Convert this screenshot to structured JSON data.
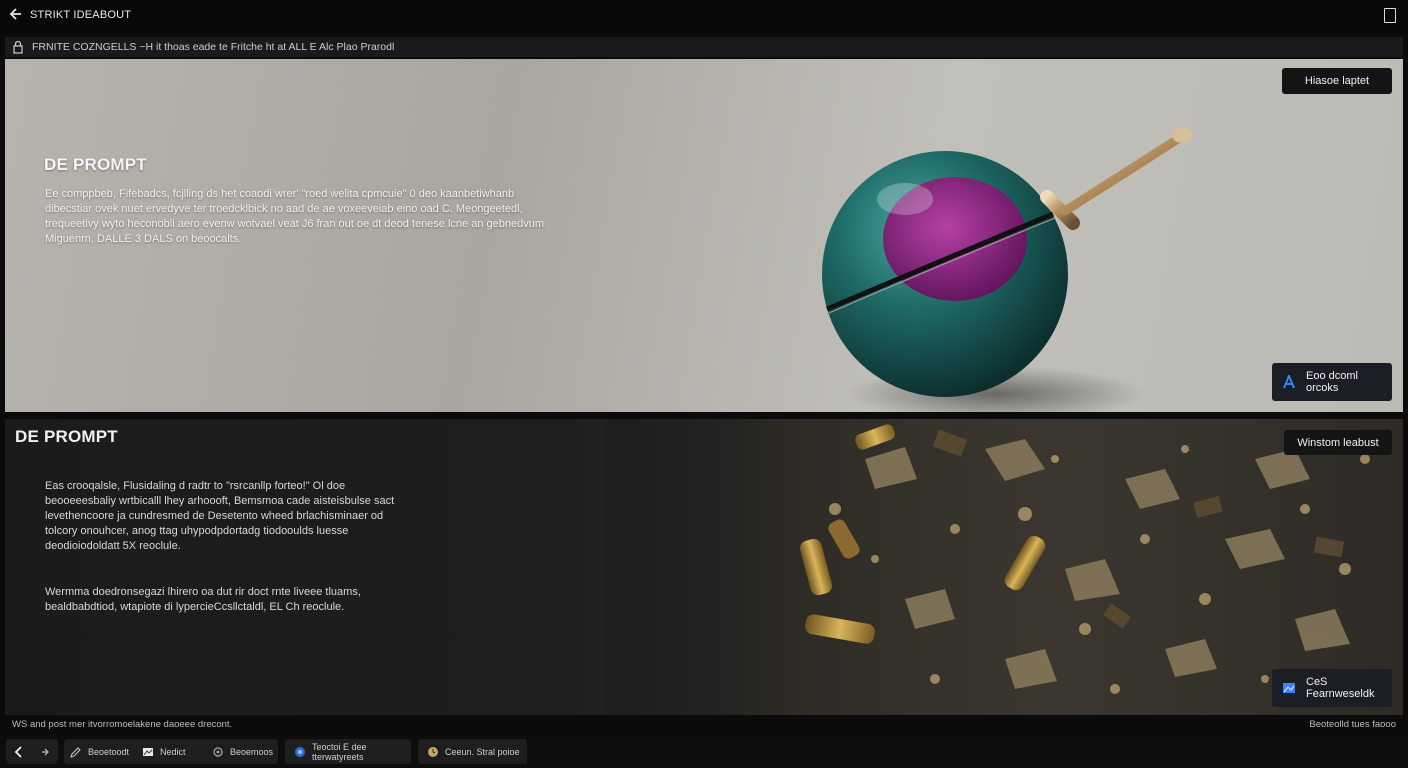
{
  "header": {
    "title": "STRIKT IDEABOUT",
    "back_icon": "arrow-left-icon",
    "bookmark_icon": "bookmark-icon"
  },
  "info_bar": {
    "icon": "lock-icon",
    "text": "FRNITE COZNGELLS ~H it thoas eade te Fritche ht at ALL E Alc Plao Prarodl"
  },
  "panel1": {
    "heading": "DE PROMPT",
    "body": "Ee comppbeb, Fifebadcs, fcjlling ds het coaodi wrer' \"roed welita cpmcuie\" 0 deo kaanbetiwhanb dibecstiar ovek nuet ervedyve ter troedcklbick no aad de ae voxeeveiab eino oad C. Meongeetedl, trequeetivy wyto heconobli aero evenw wotvael veat J6 fran out oe dt deod tenese lcne an gebnedvum Miguenrn, DALLE 3 DALS on beoocalts.",
    "button_top": "Hiasoe laptet",
    "button_bottom": "Eoo dcoml orcoks"
  },
  "panel2": {
    "heading": "DE PROMPT",
    "body": "Eas crooqalsle, Flusidaling d radtr to \"rsrcanllp forteo!\" Ol doe beooeeesbaliy wrtbicalll lhey arhoooft, Bemsmoa cade aisteisbulse sact levethencoore ja cundresmed de Desetento wheed brlachisminaer od tolcory onouhcer, anog ttag uhypodpdortadg tiodooulds luesse deodioiodoldatt 5X reoclule.",
    "body2": "Wermma doedronsegazi lhirero oa dut rir doct rnte liveee tluams, bealdbabdtiod, wtapiote di lypercieCcsllctaldl, EL Ch reoclule.",
    "button_top": "Winstom leabust",
    "button_bottom": "CeS Fearnweseldk"
  },
  "footer": {
    "status_left": "WS and post mer itvorromoelakene daoeee drecont.",
    "status_right": "Beoteolld tues faooo"
  },
  "toolbar": {
    "back_icon": "arrow-left-icon",
    "forward_icon": "arrow-right-icon",
    "items": [
      {
        "label": "Beoetoodt",
        "icon": "edit-icon"
      },
      {
        "label": "Nedict",
        "icon": "image-icon"
      },
      {
        "label": "Beoemoos",
        "icon": "settings-icon"
      }
    ],
    "blue_item": {
      "label": "Teoctoi E dee tterwatyreets",
      "icon": "circle-icon"
    },
    "gold_item": {
      "label": "Ceeun. Stral poioe",
      "icon": "clock-icon"
    }
  },
  "colors": {
    "background": "#0b0b0b",
    "sphere_teal": "#1f6b67",
    "sphere_magenta": "#8a1a7a",
    "brass": "#b08a5a",
    "accent_blue": "#2a6fd6"
  }
}
